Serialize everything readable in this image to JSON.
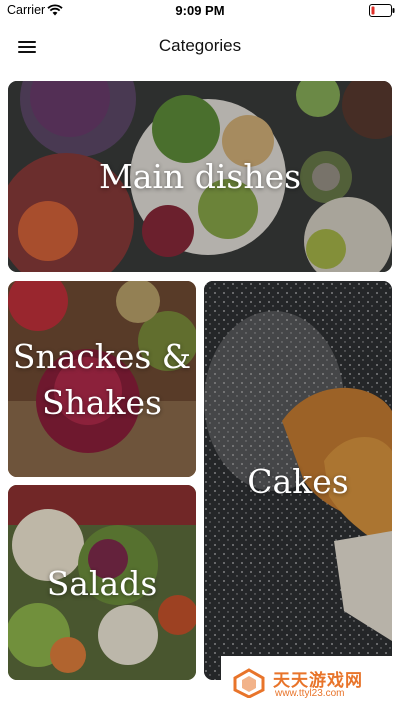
{
  "status_bar": {
    "carrier": "Carrier",
    "time": "9:09 PM",
    "wifi_icon": "wifi-icon",
    "battery_icon": "battery-low-icon",
    "battery_color": "#e0302a"
  },
  "header": {
    "title": "Categories",
    "menu_icon": "hamburger-menu-icon"
  },
  "categories": [
    {
      "label": "Main dishes"
    },
    {
      "label_line1": "Snackes &",
      "label_line2": "Shakes"
    },
    {
      "label": "Cakes"
    },
    {
      "label": "Salads"
    }
  ],
  "watermark": {
    "text": "天天游戏网",
    "url": "www.ttyl23.com",
    "color": "#e8742a"
  }
}
